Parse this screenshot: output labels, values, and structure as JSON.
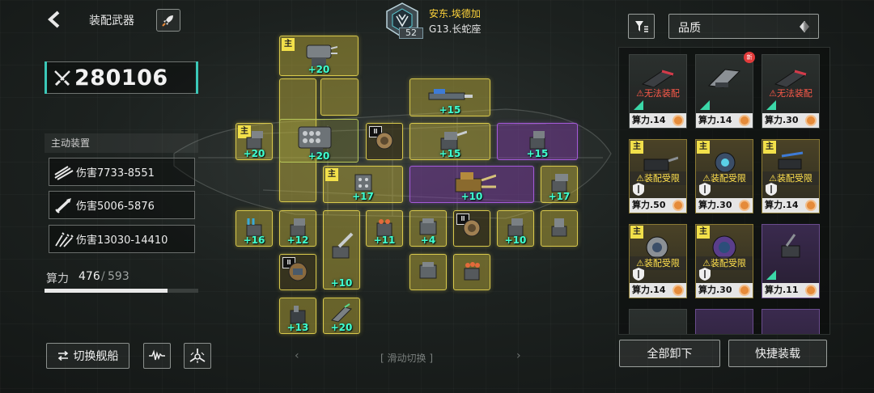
{
  "header": {
    "title": "装配武器",
    "commander_name": "安东.埃德加",
    "commander_level": "52",
    "ship_name": "G13.长蛇座"
  },
  "power": {
    "value": "280106"
  },
  "active_devices": {
    "header": "主动装置",
    "items": [
      {
        "label": "伤害7733-8551",
        "icon": "missile-volley-icon"
      },
      {
        "label": "伤害5006-5876",
        "icon": "missile-icon"
      },
      {
        "label": "伤害13030-14410",
        "icon": "scatter-missile-icon"
      }
    ]
  },
  "compute": {
    "label": "算力",
    "current": "476",
    "separator": "/",
    "max": "593",
    "fill_ratio": 0.8
  },
  "buttons": {
    "switch_ship": "切换舰船",
    "unequip_all": "全部卸下",
    "quick_equip": "快捷装载"
  },
  "slot_grid": {
    "swipe_hint": "滑动切换",
    "prev": "‹",
    "next": "›",
    "main_tag": "主",
    "rank_tag": "Ⅲ",
    "levels": {
      "s1": "+20",
      "s3": "+15",
      "s4": "+20",
      "s5": "+20",
      "s7": "+15",
      "s8": "+15",
      "s9": "+17",
      "s10": "+10",
      "s11": "+17",
      "s12": "+16",
      "s13": "+12",
      "s14": "+10",
      "s15": "+11",
      "s16": "+4",
      "s18": "+10",
      "s22": "+13",
      "s23": "+20"
    }
  },
  "inventory": {
    "sort_label": "品质",
    "new_badge": "新",
    "main_tag": "主",
    "warn_unequippable": "无法装配",
    "warn_limited": "装配受限",
    "costs": [
      "算力.14",
      "算力.14",
      "算力.30",
      "算力.50",
      "算力.30",
      "算力.14",
      "算力.14",
      "算力.30",
      "算力.11"
    ]
  },
  "colors": {
    "slot_yellow": "#d8c84c",
    "slot_purple": "#a45ad8",
    "level_text": "#3fffd0",
    "warn_red": "#ff5a4a",
    "warn_yellow": "#ffe04d",
    "accent_teal": "#3bc8b8"
  }
}
